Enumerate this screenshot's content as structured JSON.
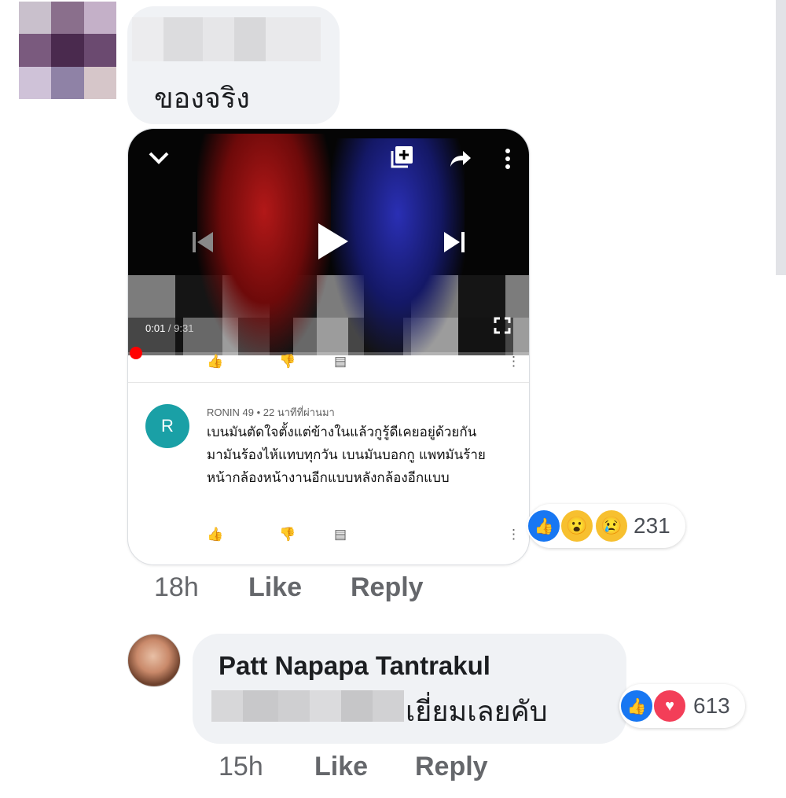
{
  "comment1": {
    "text": "ของจริง",
    "time": "18h",
    "like_label": "Like",
    "reply_label": "Reply",
    "reactions": {
      "types": [
        "like-icon",
        "wow-icon",
        "sad-icon"
      ],
      "count": "231"
    },
    "screenshot": {
      "video": {
        "current_time": "0:01",
        "separator": " / ",
        "duration": "9:31",
        "progress_fraction": 0.003
      },
      "yt_comment": {
        "avatar_letter": "R",
        "author": "RONIN 49",
        "meta_sep": " • ",
        "age": "22 นาทีที่ผ่านมา",
        "text": "เบนมันตัดใจตั้งแต่ข้างในแล้วกูรู้ดีเคยอยู่ด้วยกันมามันร้องไห้แทบทุกวัน เบนมันบอกกู แพทมันร้าย หน้ากล้องหน้างานอีกแบบหลังกล้องอีกแบบ"
      }
    }
  },
  "reply": {
    "author": "Patt Napapa Tantrakul",
    "text": "เยี่ยมเลยคับ",
    "time": "15h",
    "like_label": "Like",
    "reply_label": "Reply",
    "reactions": {
      "types": [
        "like-icon",
        "love-icon"
      ],
      "count": "613"
    }
  },
  "colors": {
    "bubble_bg": "#f0f2f5",
    "like_blue": "#1877f2",
    "love_red": "#f33e58",
    "action_gray": "#65676b",
    "yt_avatar_teal": "#1aa0a6",
    "yt_progress_red": "#ff0000"
  }
}
